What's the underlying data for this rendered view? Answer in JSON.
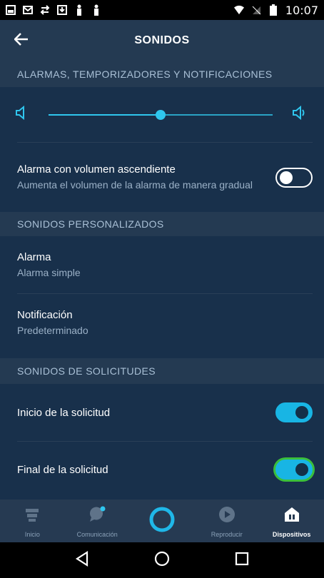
{
  "status_bar": {
    "time": "10:07",
    "left_icons": [
      "image-icon",
      "mail-icon",
      "transfer-icon",
      "download-icon",
      "figure-icon",
      "figure-icon"
    ],
    "right_icons": [
      "wifi-icon",
      "no-sim-icon",
      "battery-icon"
    ]
  },
  "header": {
    "title": "SONIDOS",
    "back_icon": "back-arrow-icon"
  },
  "sections": {
    "alarms_header": "ALARMAS, TEMPORIZADORES Y NOTIFICACIONES",
    "volume": {
      "level": 0.5
    },
    "ascending": {
      "title": "Alarma con volumen ascendiente",
      "subtitle": "Aumenta el volumen de la alarma de manera gradual",
      "on": false
    },
    "custom_header": "SONIDOS PERSONALIZADOS",
    "alarm": {
      "title": "Alarma",
      "value": "Alarma simple"
    },
    "notification": {
      "title": "Notificación",
      "value": "Predeterminado"
    },
    "requests_header": "SONIDOS DE SOLICITUDES",
    "start_request": {
      "title": "Inicio de la solicitud",
      "on": true
    },
    "end_request": {
      "title": "Final de la solicitud",
      "on": true
    }
  },
  "bottom_nav": {
    "items": [
      {
        "label": "Inicio",
        "icon": "home-icon"
      },
      {
        "label": "Comunicación",
        "icon": "chat-icon"
      },
      {
        "label": "",
        "icon": "alexa-ring-icon"
      },
      {
        "label": "Reproducir",
        "icon": "play-icon"
      },
      {
        "label": "Dispositivos",
        "icon": "devices-icon",
        "active": true
      }
    ]
  },
  "colors": {
    "accent": "#18b5e4",
    "background": "#18304b",
    "section_header": "#243a52"
  }
}
